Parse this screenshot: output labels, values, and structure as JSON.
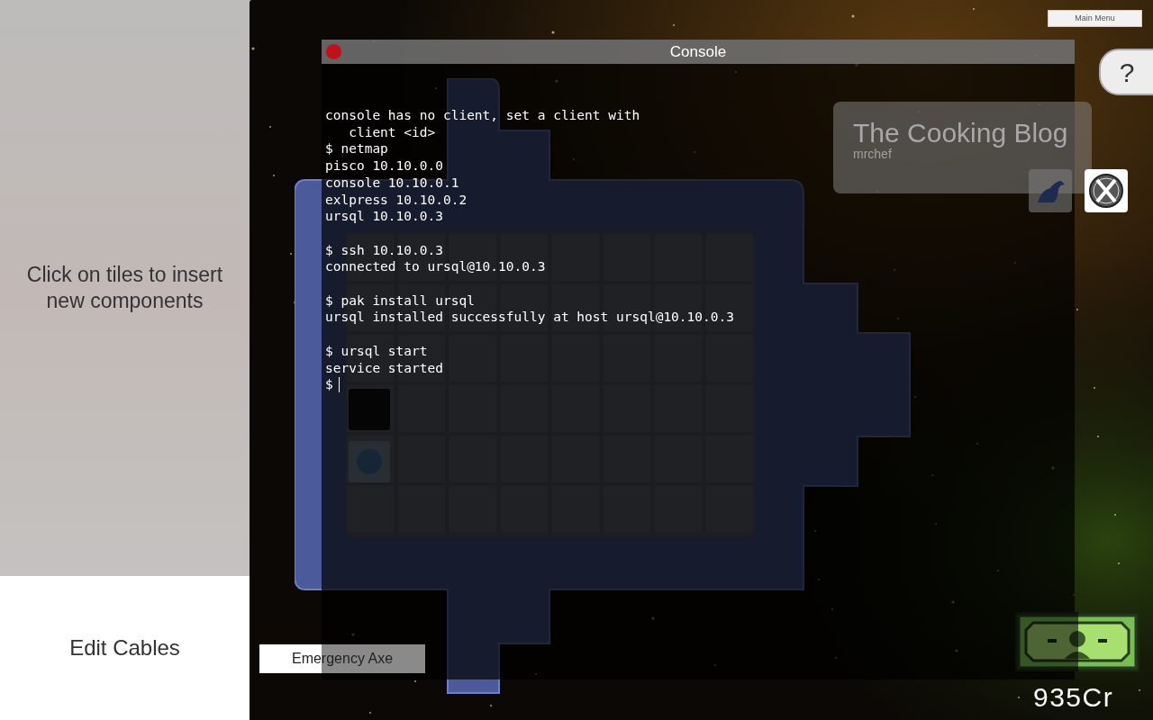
{
  "sidebar": {
    "hint": "Click on tiles to insert new components",
    "edit_cables_button": "Edit Cables"
  },
  "main_menu_button": "Main Menu",
  "help_button": "?",
  "console": {
    "title": "Console",
    "blocks": [
      [
        "console has no client, set a client with",
        "   client <id>",
        "$ netmap",
        "pisco 10.10.0.0",
        "console 10.10.0.1",
        "exlpress 10.10.0.2",
        "ursql 10.10.0.3"
      ],
      [
        "$ ssh 10.10.0.3",
        "connected to ursql@10.10.0.3"
      ],
      [
        "$ pak install ursql",
        "ursql installed successfully at host ursql@10.10.0.3"
      ],
      [
        "$ ursql start",
        "service started"
      ]
    ],
    "prompt": "$"
  },
  "blog_card": {
    "title": "The Cooking Blog",
    "author": "mrchef"
  },
  "emergency_button": "Emergency Axe",
  "credits": "935Cr"
}
